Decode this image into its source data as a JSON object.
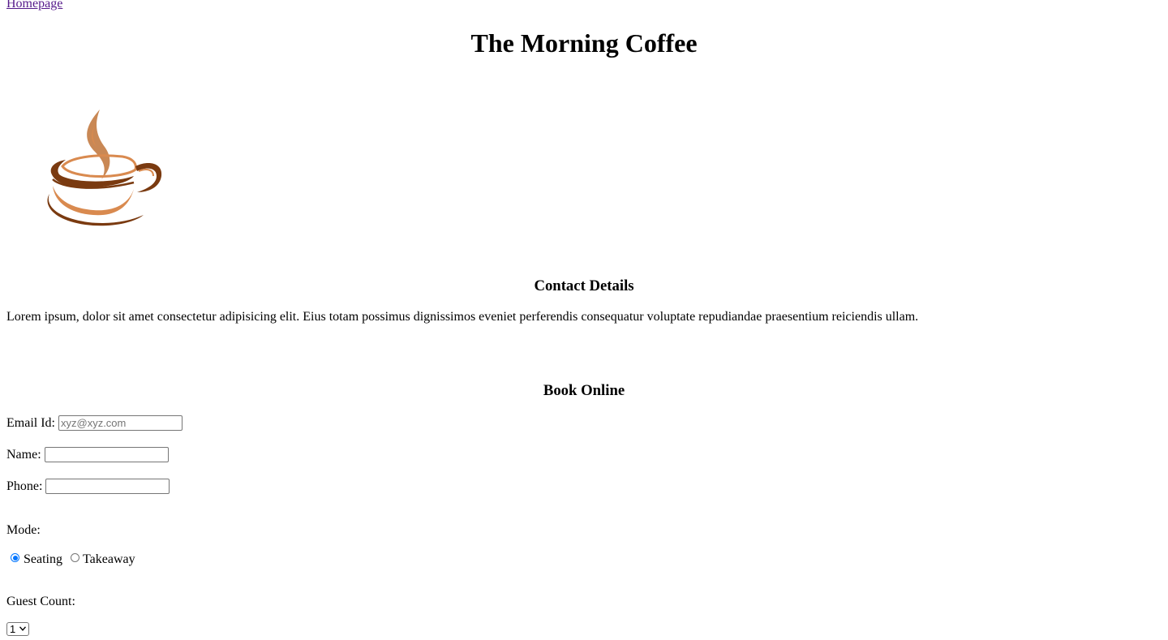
{
  "nav": {
    "home_link": "Homepage"
  },
  "header": {
    "title": "The Morning Coffee"
  },
  "logo": {
    "icon": "coffee-cup-icon",
    "colors": {
      "steam": "#c98855",
      "cup_dark": "#7a3a10",
      "cup_light": "#d98a4f"
    }
  },
  "contact": {
    "heading": "Contact Details",
    "text": "Lorem ipsum, dolor sit amet consectetur adipisicing elit. Eius totam possimus dignissimos eveniet perferendis consequatur voluptate repudiandae praesentium reiciendis ullam."
  },
  "booking": {
    "heading": "Book Online",
    "email": {
      "label": "Email Id:",
      "placeholder": "xyz@xyz.com",
      "value": ""
    },
    "name": {
      "label": "Name:",
      "value": ""
    },
    "phone": {
      "label": "Phone:",
      "value": ""
    },
    "mode": {
      "label": "Mode:",
      "options": [
        {
          "label": "Seating",
          "selected": true
        },
        {
          "label": "Takeaway",
          "selected": false
        }
      ]
    },
    "guest_count": {
      "label": "Guest Count:",
      "selected": "1"
    }
  },
  "colors": {
    "link": "#551a8b",
    "radio_accent": "#0075ff"
  }
}
